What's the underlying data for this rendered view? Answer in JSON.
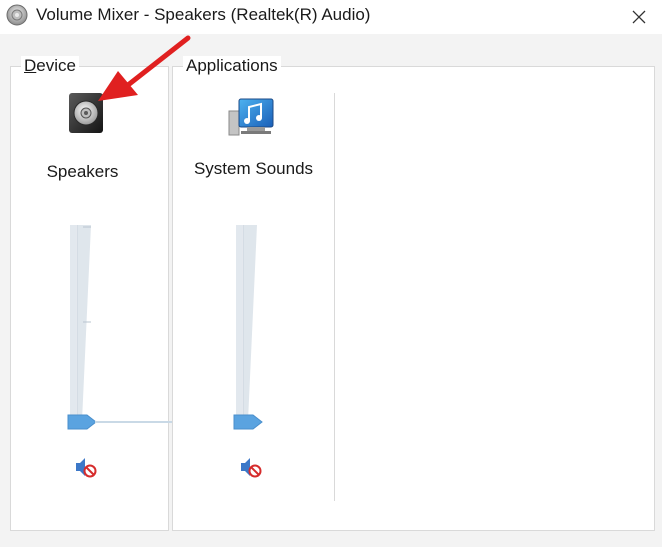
{
  "window": {
    "title": "Volume Mixer - Speakers (Realtek(R) Audio)",
    "icons": {
      "app": "speaker-icon",
      "close": "close-icon"
    }
  },
  "device": {
    "group_label": "Device",
    "channel": {
      "name": "Speakers",
      "icon": "speakers-device-icon",
      "volume_percent": 0,
      "muted": true
    }
  },
  "applications": {
    "group_label": "Applications",
    "channels": [
      {
        "name": "System Sounds",
        "icon": "system-sounds-icon",
        "volume_percent": 0,
        "muted": true
      }
    ]
  },
  "colors": {
    "thumb": "#5aa3e0",
    "annotation_arrow": "#e02020"
  }
}
